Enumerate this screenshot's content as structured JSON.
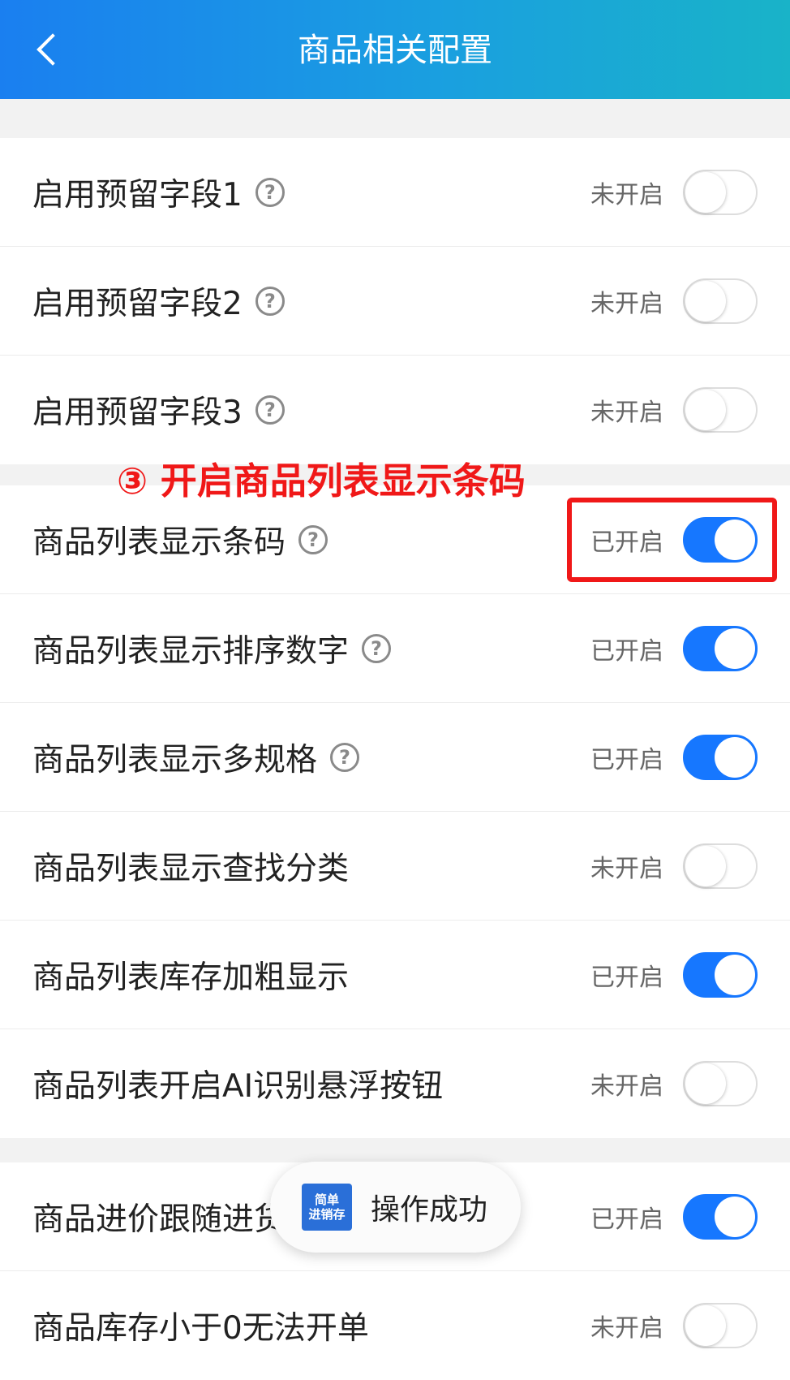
{
  "header": {
    "title": "商品相关配置",
    "back_icon": "chevron-left-icon"
  },
  "colors": {
    "accent": "#1677ff",
    "annotation": "#f01818",
    "header_from": "#1a7ff0",
    "header_to": "#19b3c8"
  },
  "settings": [
    {
      "label": "启用预留字段1",
      "help": "?",
      "status": "未开启",
      "on": false
    },
    {
      "label": "启用预留字段2",
      "help": "?",
      "status": "未开启",
      "on": false
    },
    {
      "label": "启用预留字段3",
      "help": "?",
      "status": "未开启",
      "on": false
    },
    {
      "label": "商品列表显示条码",
      "help": "?",
      "status": "已开启",
      "on": true
    },
    {
      "label": "商品列表显示排序数字",
      "help": "?",
      "status": "已开启",
      "on": true
    },
    {
      "label": "商品列表显示多规格",
      "help": "?",
      "status": "已开启",
      "on": true
    },
    {
      "label": "商品列表显示查找分类",
      "status": "未开启",
      "on": false
    },
    {
      "label": "商品列表库存加粗显示",
      "status": "已开启",
      "on": true
    },
    {
      "label": "商品列表开启AI识别悬浮按钮",
      "status": "未开启",
      "on": false
    },
    {
      "label": "商品进价跟随进货",
      "status": "已开启",
      "on": true
    },
    {
      "label": "商品库存小于0无法开单",
      "status": "未开启",
      "on": false
    }
  ],
  "annotation": {
    "text": "③ 开启商品列表显示条码"
  },
  "toast": {
    "logo_line1": "简单",
    "logo_line2": "进销存",
    "text": "操作成功"
  }
}
